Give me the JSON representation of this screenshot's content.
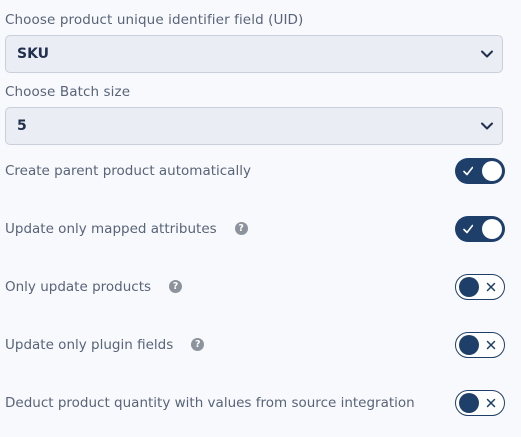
{
  "uid_field": {
    "label": "Choose product unique identifier field (UID)",
    "selected": "SKU"
  },
  "batch_size": {
    "label": "Choose Batch size",
    "selected": "5"
  },
  "settings": [
    {
      "label": "Create parent product automatically",
      "has_help": false,
      "enabled": true
    },
    {
      "label": "Update only mapped attributes",
      "has_help": true,
      "enabled": true
    },
    {
      "label": "Only update products",
      "has_help": true,
      "enabled": false
    },
    {
      "label": "Update only plugin fields",
      "has_help": true,
      "enabled": false
    },
    {
      "label": "Deduct product quantity with values from source integration",
      "has_help": false,
      "enabled": false
    }
  ],
  "help_symbol": "?",
  "icons": {
    "select_arrow": "chevron-down-icon",
    "toggle_on": "check-icon",
    "toggle_off": "x-icon",
    "help": "question-circle-icon"
  },
  "colors": {
    "accent": "#1f3f6b",
    "select_bg": "#eaedf3",
    "page_bg": "#f8f9fc",
    "help_icon": "#8d939c"
  }
}
